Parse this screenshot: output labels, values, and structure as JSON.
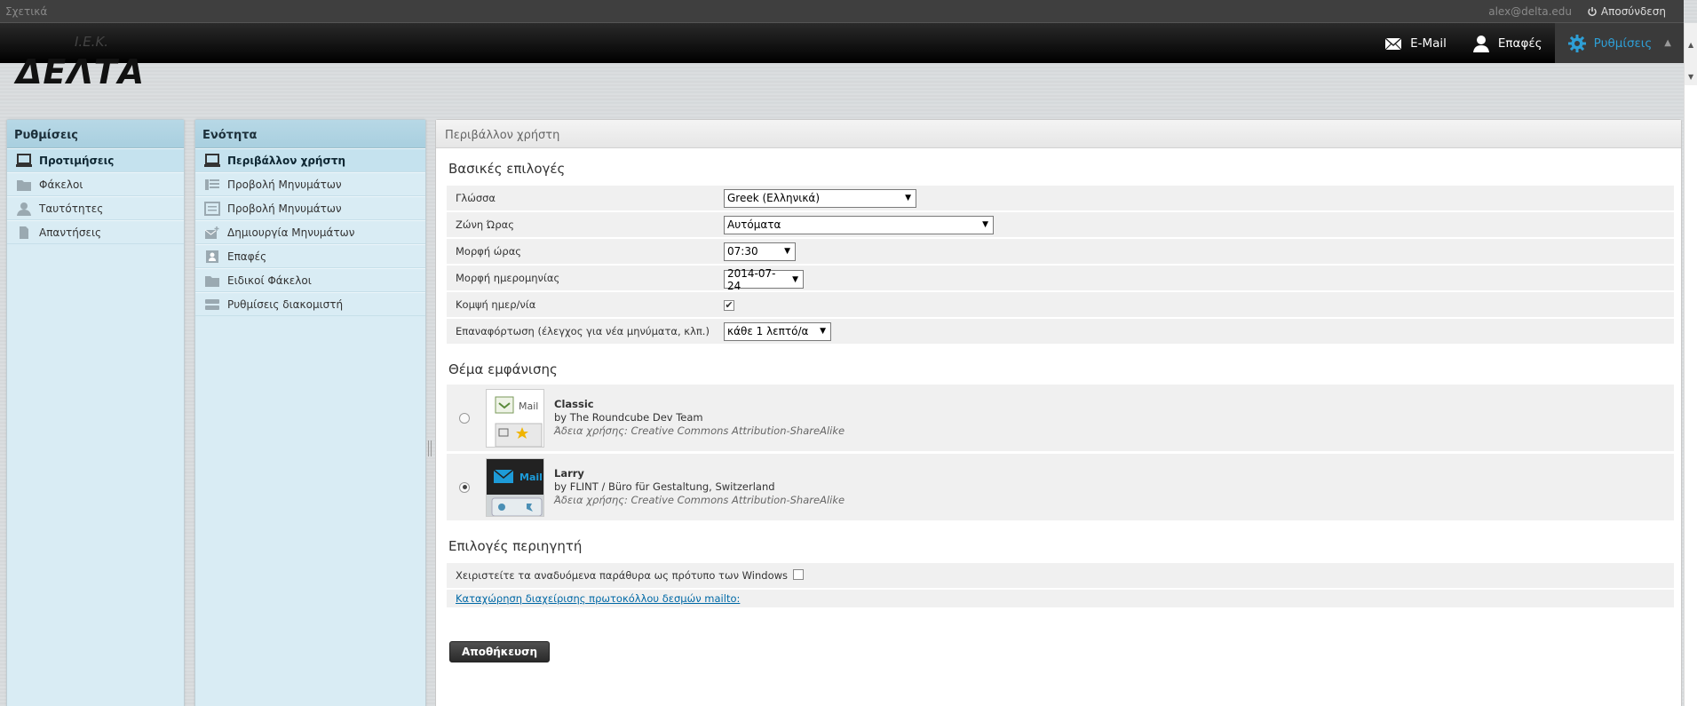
{
  "topline": {
    "about": "Σχετικά",
    "user_email": "alex@delta.edu",
    "logout": "Αποσύνδεση"
  },
  "logo": {
    "top": "I.E.K.",
    "main": "ΔΕΛΤΑ"
  },
  "topnav": [
    {
      "label": "E-Mail",
      "icon": "envelope-icon"
    },
    {
      "label": "Επαφές",
      "icon": "person-icon"
    },
    {
      "label": "Ρυθμίσεις",
      "icon": "gear-icon",
      "selected": true
    }
  ],
  "settings_panel": {
    "title": "Ρυθμίσεις",
    "items": [
      {
        "label": "Προτιμήσεις",
        "icon": "monitor-icon",
        "selected": true
      },
      {
        "label": "Φάκελοι",
        "icon": "folder-icon"
      },
      {
        "label": "Ταυτότητες",
        "icon": "person-icon"
      },
      {
        "label": "Απαντήσεις",
        "icon": "document-icon"
      }
    ]
  },
  "section_panel": {
    "title": "Ενότητα",
    "items": [
      {
        "label": "Περιβάλλον χρήστη",
        "icon": "monitor-icon",
        "selected": true
      },
      {
        "label": "Προβολή Μηνυμάτων",
        "icon": "list-view-icon"
      },
      {
        "label": "Προβολή Μηνυμάτων",
        "icon": "message-view-icon"
      },
      {
        "label": "Δημιουργία Μηνυμάτων",
        "icon": "compose-icon"
      },
      {
        "label": "Επαφές",
        "icon": "addressbook-icon"
      },
      {
        "label": "Ειδικοί Φάκελοι",
        "icon": "folder-icon"
      },
      {
        "label": "Ρυθμίσεις διακομιστή",
        "icon": "server-icon"
      }
    ]
  },
  "main": {
    "title": "Περιβάλλον χρήστη",
    "basic": {
      "legend": "Βασικές επιλογές",
      "language_label": "Γλώσσα",
      "language_value": "Greek (Ελληνικά)",
      "timezone_label": "Ζώνη Ώρας",
      "timezone_value": "Αυτόματα",
      "time_format_label": "Μορφή ώρας",
      "time_format_value": "07:30",
      "date_format_label": "Μορφή ημερομηνίας",
      "date_format_value": "2014-07-24",
      "pretty_date_label": "Κομψή ημερ/νία",
      "pretty_date_checked": true,
      "refresh_label": "Επαναφόρτωση (έλεγχος για νέα μηνύματα, κλπ.)",
      "refresh_value": "κάθε 1 λεπτό/α"
    },
    "skin": {
      "legend": "Θέμα εμφάνισης",
      "skins": [
        {
          "name": "Classic",
          "author": "by The Roundcube Dev Team",
          "license": "Άδεια χρήσης: Creative Commons Attribution-ShareAlike",
          "thumb_label": "Mail",
          "selected": false
        },
        {
          "name": "Larry",
          "author": "by FLINT / Büro für Gestaltung, Switzerland",
          "license": "Άδεια χρήσης: Creative Commons Attribution-ShareAlike",
          "thumb_label": "Mail",
          "selected": true
        }
      ]
    },
    "browser": {
      "legend": "Επιλογές περιηγητή",
      "popup_label": "Χειριστείτε τα αναδυόμενα παράθυρα ως πρότυπο των Windows",
      "popup_checked": false,
      "mailto_link": "Καταχώρηση διαχείρισης πρωτοκόλλου δεσμών mailto:"
    },
    "save_label": "Αποθήκευση"
  },
  "colors": {
    "accent": "#2e9fd6",
    "panel_bg": "#d9ecf4",
    "header_bg": "#000000"
  }
}
